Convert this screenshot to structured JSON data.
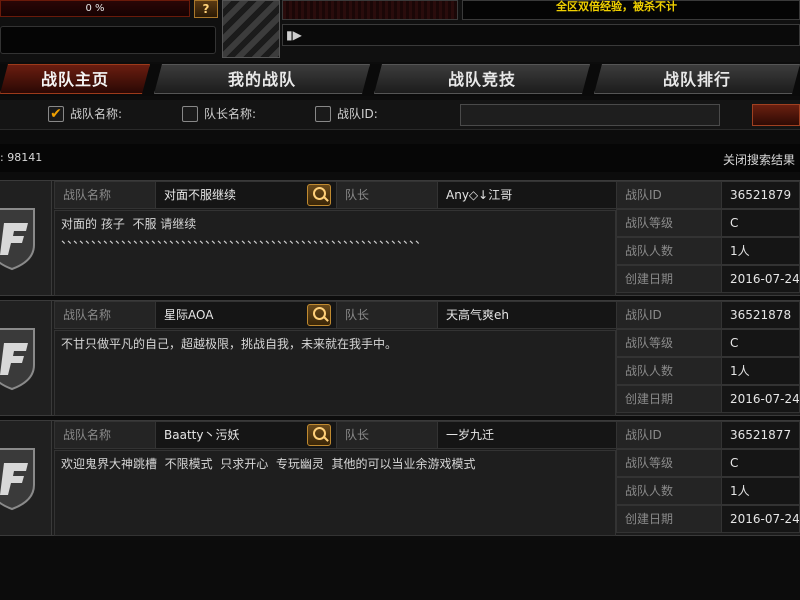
{
  "topbar": {
    "progress_text": "0 %",
    "help_label": "?",
    "exp_banner": "全区双倍经验，被杀不计"
  },
  "tabs": [
    {
      "label": "战队主页",
      "active": true
    },
    {
      "label": "我的战队",
      "active": false
    },
    {
      "label": "战队竞技",
      "active": false
    },
    {
      "label": "战队排行",
      "active": false
    }
  ],
  "search": {
    "options": [
      {
        "label": "战队名称:",
        "checked": true
      },
      {
        "label": "队长名称:",
        "checked": false
      },
      {
        "label": "战队ID:",
        "checked": false
      }
    ],
    "input_value": ""
  },
  "results": {
    "count_text": ": 98141",
    "close_label": "关闭搜索结果"
  },
  "labels": {
    "clan_name": "战队名称",
    "leader": "队长",
    "clan_id": "战队ID",
    "clan_level": "战队等级",
    "member_count": "战队人数",
    "created": "创建日期"
  },
  "clans": [
    {
      "name": "对面不服继续",
      "leader": "Any◇↓江哥",
      "description": "对面的 孩子  不服 请继续\n、、、、、、、、、、、、、、、、、、、、、、、、、、、、、、、、、、、、、、、、、、、、、、、、、、、、、、、、、、、、",
      "id": "36521879",
      "level": "C",
      "members": "1人",
      "created": "2016-07-24"
    },
    {
      "name": "星际AOA",
      "leader": "天高气爽eh",
      "description": "不甘只做平凡的自己，超越极限，挑战自我，未来就在我手中。",
      "id": "36521878",
      "level": "C",
      "members": "1人",
      "created": "2016-07-24"
    },
    {
      "name": "Baatty丶污妖",
      "leader": "一岁九迁",
      "description": "欢迎鬼界大神跳槽  不限模式  只求开心  专玩幽灵  其他的可以当业余游戏模式",
      "id": "36521877",
      "level": "C",
      "members": "1人",
      "created": "2016-07-24"
    }
  ],
  "colors": {
    "accent_red": "#6a1d10",
    "exp_yellow": "#f0d000",
    "check_orange": "#f0a000"
  },
  "icons": [
    "help-icon",
    "volume-icon",
    "checkbox-icon",
    "magnifier-icon",
    "clan-emblem-icon"
  ]
}
